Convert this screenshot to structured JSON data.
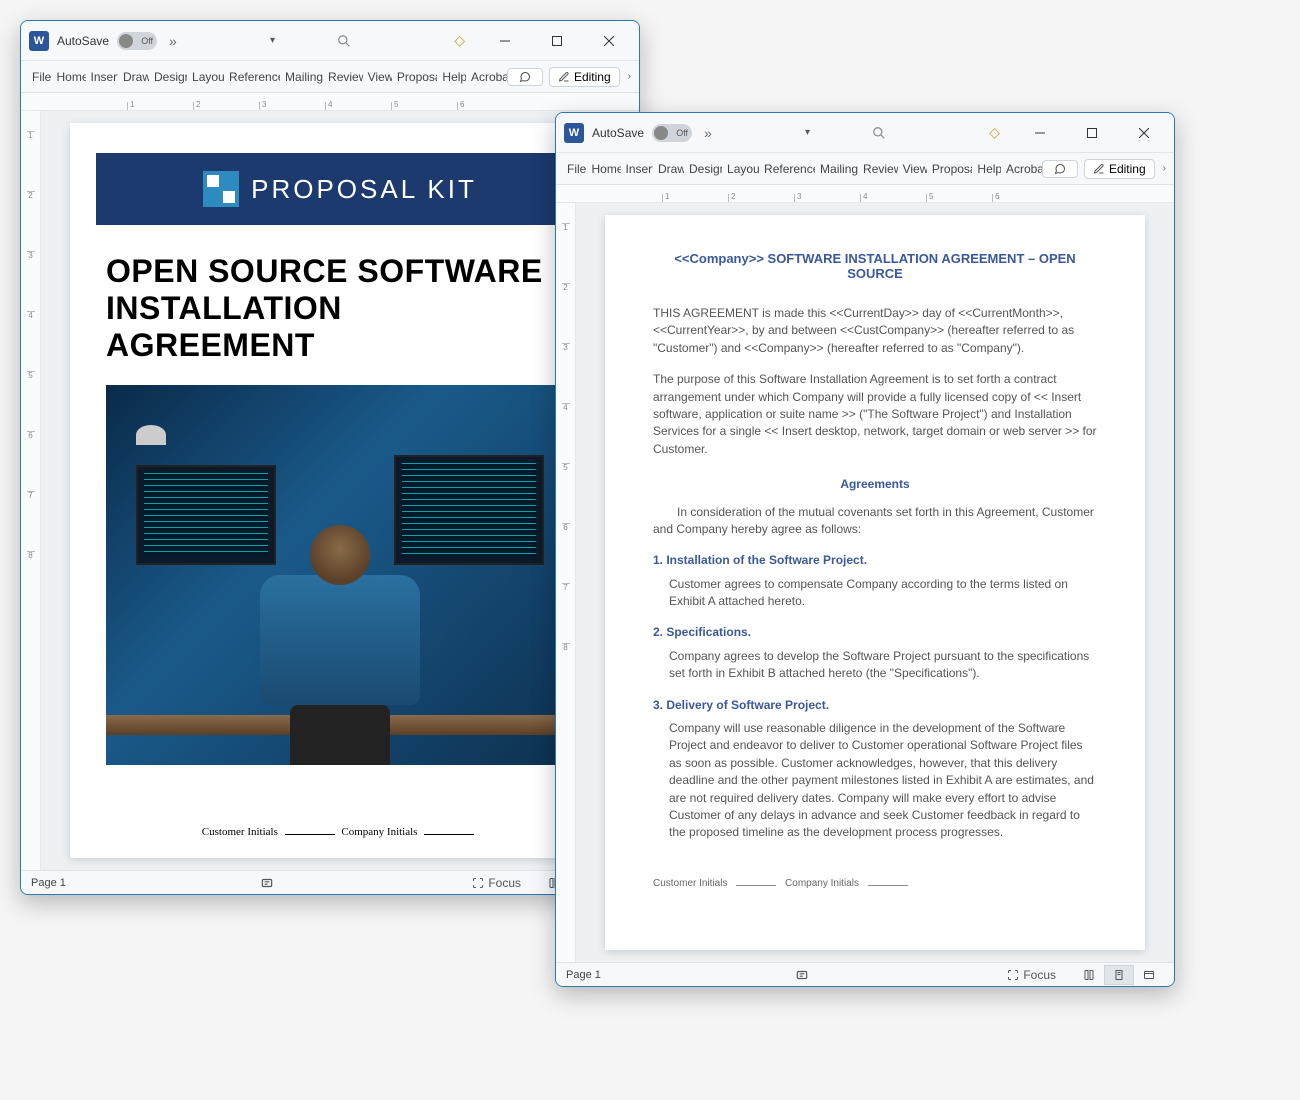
{
  "window1": {
    "autosave_label": "AutoSave",
    "autosave_state": "Off",
    "ribbon": [
      "File",
      "Home",
      "Insert",
      "Draw",
      "Design",
      "Layout",
      "References",
      "Mailings",
      "Review",
      "View",
      "Proposal",
      "Help",
      "Acrobat"
    ],
    "editing_label": "Editing",
    "page_label": "Page 1",
    "focus_label": "Focus",
    "doc": {
      "brand": "PROPOSAL KIT",
      "title_l1": "OPEN SOURCE SOFTWARE",
      "title_l2": "INSTALLATION",
      "title_l3": "AGREEMENT",
      "cust_initials": "Customer Initials",
      "comp_initials": "Company Initials"
    }
  },
  "window2": {
    "autosave_label": "AutoSave",
    "autosave_state": "Off",
    "ribbon": [
      "File",
      "Home",
      "Insert",
      "Draw",
      "Design",
      "Layout",
      "References",
      "Mailings",
      "Review",
      "View",
      "Proposal",
      "Help",
      "Acrobat"
    ],
    "editing_label": "Editing",
    "page_label": "Page 1",
    "focus_label": "Focus",
    "doc": {
      "title": "<<Company>> SOFTWARE INSTALLATION AGREEMENT – OPEN SOURCE",
      "p1": "THIS AGREEMENT is made this <<CurrentDay>> day of <<CurrentMonth>>, <<CurrentYear>>, by and between <<CustCompany>> (hereafter referred to as \"Customer\") and <<Company>> (hereafter referred to as \"Company\").",
      "p2": "The purpose of this Software Installation Agreement is to set forth a contract arrangement under which Company will provide a fully licensed copy of << Insert software, application or suite name >> (\"The Software Project\") and Installation Services for a single << Insert desktop, network, target domain or web server >> for Customer.",
      "h_agreements": "Agreements",
      "p3": "In consideration of the mutual covenants set forth in this Agreement, Customer and Company hereby agree as follows:",
      "s1_h": "1. Installation of the Software Project.",
      "s1_b": "Customer agrees to compensate Company according to the terms listed on Exhibit A attached hereto.",
      "s2_h": "2. Specifications.",
      "s2_b": "Company agrees to develop the Software Project pursuant to the specifications set forth in Exhibit B attached hereto (the \"Specifications\").",
      "s3_h": "3. Delivery of Software Project.",
      "s3_b": "Company will use reasonable diligence in the development of the Software Project and endeavor to deliver to Customer operational Software Project files as soon as possible. Customer acknowledges, however, that this delivery deadline and the other payment milestones listed in Exhibit A are estimates, and are not required delivery dates. Company will make every effort to advise Customer of any delays in advance and seek Customer feedback in regard to the proposed timeline as the development process progresses.",
      "cust_initials": "Customer Initials",
      "comp_initials": "Company Initials"
    }
  },
  "ruler_nums": [
    "1",
    "2",
    "3",
    "4",
    "5",
    "6",
    "7",
    "8"
  ]
}
